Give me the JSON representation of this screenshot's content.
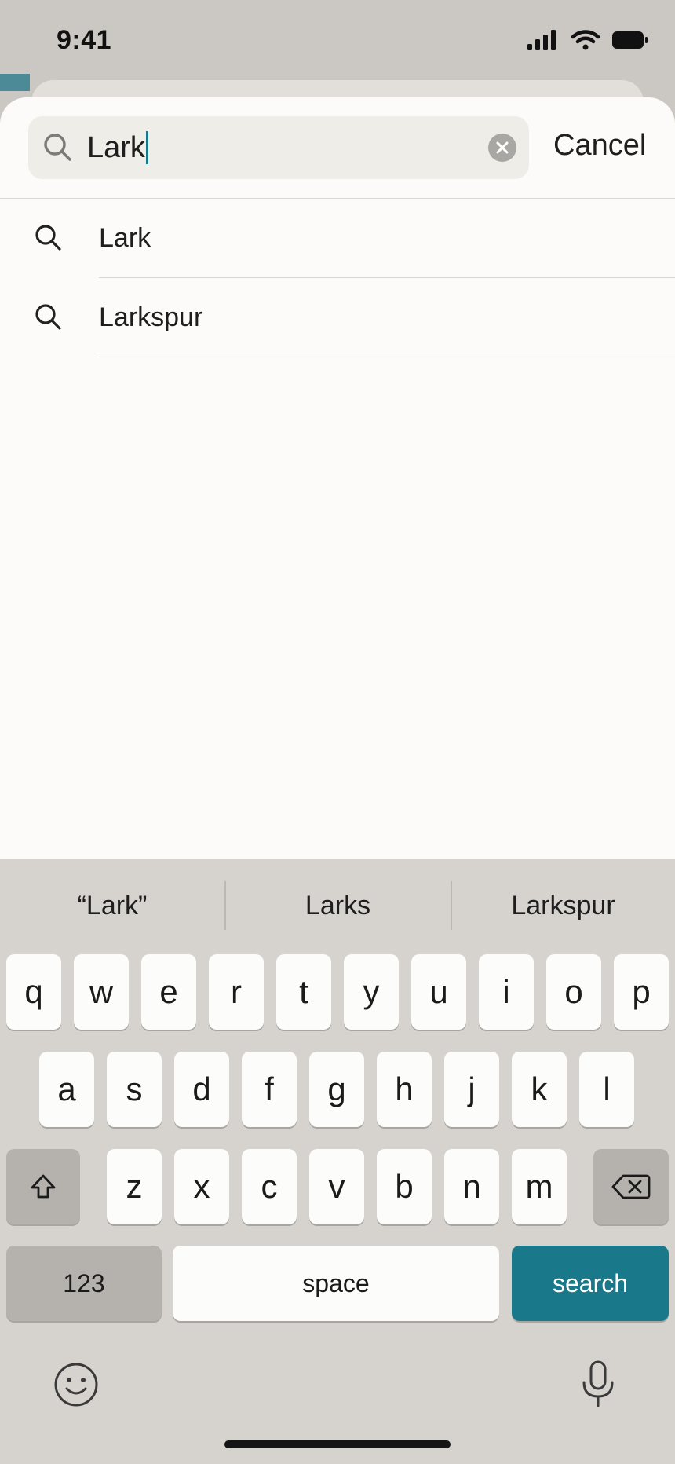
{
  "status_bar": {
    "time": "9:41",
    "icons": [
      "cellular-signal-icon",
      "wifi-icon",
      "battery-icon"
    ]
  },
  "search": {
    "value": "Lark",
    "cancel_label": "Cancel",
    "icon": "search-icon",
    "clear_icon": "clear-icon"
  },
  "suggestions": [
    {
      "label": "Lark",
      "icon": "search-icon"
    },
    {
      "label": "Larkspur",
      "icon": "search-icon"
    }
  ],
  "keyboard": {
    "predictions": [
      "“Lark”",
      "Larks",
      "Larkspur"
    ],
    "row1": [
      "q",
      "w",
      "e",
      "r",
      "t",
      "y",
      "u",
      "i",
      "o",
      "p"
    ],
    "row2": [
      "a",
      "s",
      "d",
      "f",
      "g",
      "h",
      "j",
      "k",
      "l"
    ],
    "row3": [
      "z",
      "x",
      "c",
      "v",
      "b",
      "n",
      "m"
    ],
    "numbers_label": "123",
    "space_label": "space",
    "search_label": "search"
  },
  "colors": {
    "accent": "#19798a",
    "sheet_background": "#fcfbf9",
    "keyboard_background": "#d6d3cf"
  }
}
